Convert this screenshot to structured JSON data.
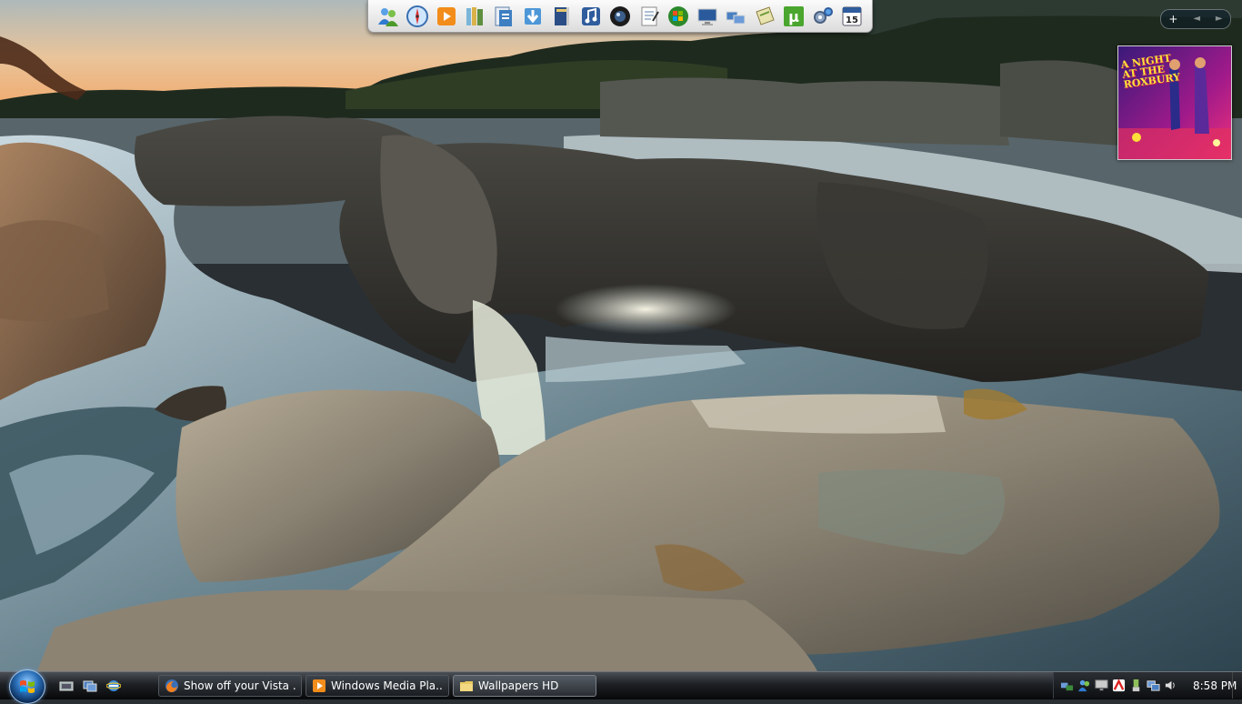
{
  "dock": {
    "items": [
      {
        "name": "messenger-icon"
      },
      {
        "name": "safari-icon"
      },
      {
        "name": "media-player-icon"
      },
      {
        "name": "library-books-icon"
      },
      {
        "name": "documents-icon"
      },
      {
        "name": "downloads-icon"
      },
      {
        "name": "book-icon"
      },
      {
        "name": "music-icon"
      },
      {
        "name": "webcam-icon"
      },
      {
        "name": "notepad-icon"
      },
      {
        "name": "windows-logo-icon"
      },
      {
        "name": "computer-icon"
      },
      {
        "name": "network-icon"
      },
      {
        "name": "notes-icon"
      },
      {
        "name": "utorrent-icon",
        "text": "µ"
      },
      {
        "name": "settings-gears-icon"
      },
      {
        "name": "calendar-icon",
        "text": "15"
      }
    ]
  },
  "sidebar": {
    "add_label": "+",
    "prev_label": "◄",
    "next_label": "►",
    "album_gadget": {
      "title": "A NIGHT AT THE ROXBURY"
    }
  },
  "taskbar": {
    "quick_launch": [
      "show-desktop-icon",
      "switch-windows-icon",
      "internet-explorer-icon"
    ],
    "tasks": [
      {
        "label": "Show off your Vista ...",
        "icon": "firefox-icon",
        "active": false
      },
      {
        "label": "Windows Media Pla...",
        "icon": "media-player-icon",
        "active": false
      },
      {
        "label": "Wallpapers HD",
        "icon": "folder-icon",
        "active": true
      }
    ],
    "tray": {
      "icons": [
        "network-status-icon",
        "messenger-status-icon",
        "display-icon",
        "antivirus-icon",
        "safely-remove-icon",
        "connections-icon",
        "volume-icon"
      ],
      "clock": "8:58 PM"
    }
  },
  "colors": {
    "taskbar_top": "#4a4f55",
    "taskbar_bottom": "#070809",
    "sky_top": "#b8c6c9",
    "sunset": "#f0a968"
  }
}
